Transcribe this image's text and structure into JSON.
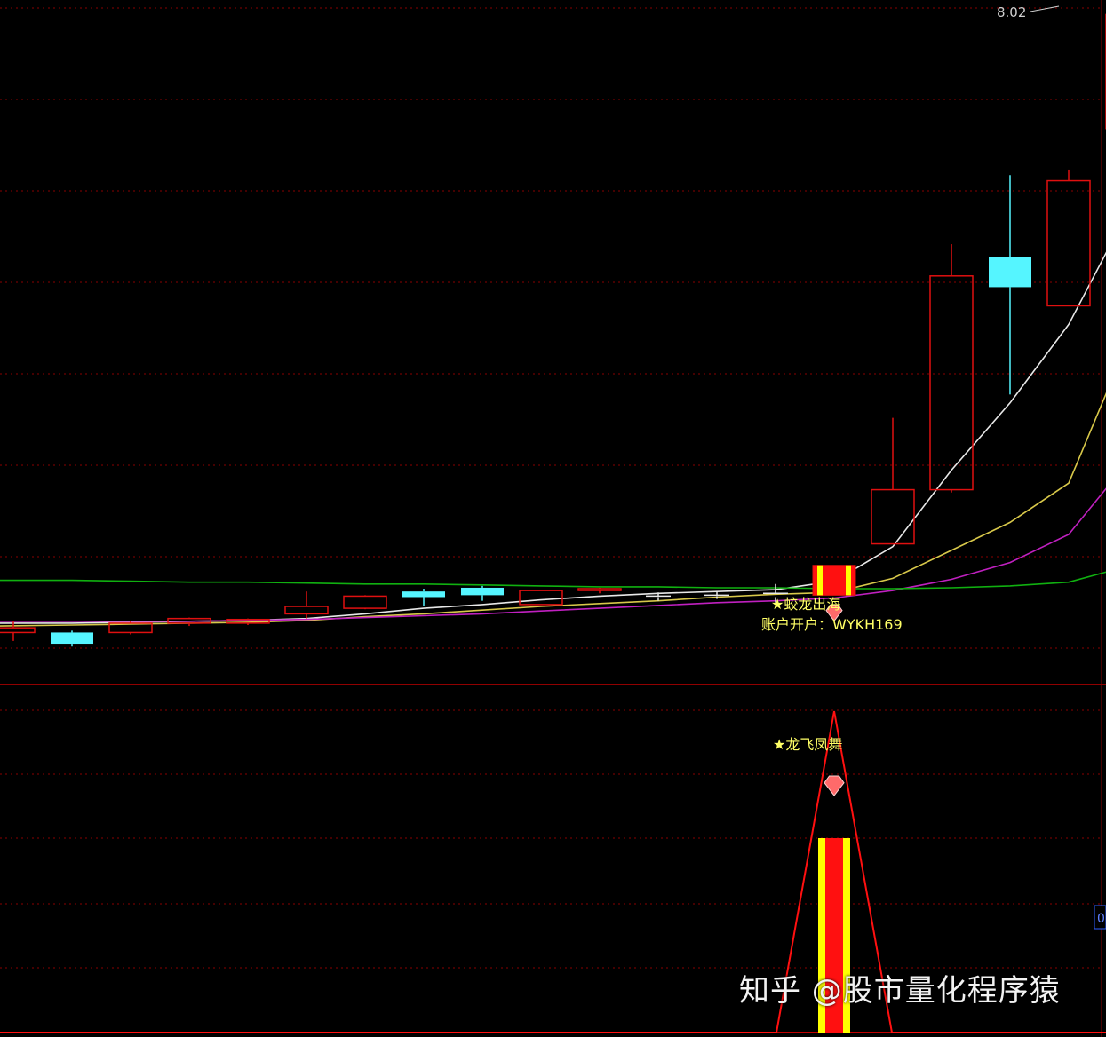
{
  "chart_data": [
    {
      "type": "candlestick",
      "panel": "main",
      "price_readout": "8.02",
      "colors": {
        "up": "#e01010",
        "down": "#55f5ff",
        "doji": "#e8e8e8",
        "grid": "#8a0000",
        "ma_short": "#e8e8e8",
        "ma_mid": "#d8c84a",
        "ma_long": "#c020c0",
        "ma_longest": "#10b010",
        "signal_fill": "#ff1010",
        "signal_stripe": "#ffff00",
        "text": "#ffff66"
      },
      "candles": [
        {
          "i": 0,
          "open": 1.45,
          "high": 1.52,
          "low": 1.31,
          "close": 1.4,
          "dir": "up"
        },
        {
          "i": 1,
          "open": 1.4,
          "high": 1.42,
          "low": 1.25,
          "close": 1.28,
          "dir": "down"
        },
        {
          "i": 2,
          "open": 1.4,
          "high": 1.52,
          "low": 1.38,
          "close": 1.5,
          "dir": "up"
        },
        {
          "i": 3,
          "open": 1.5,
          "high": 1.56,
          "low": 1.47,
          "close": 1.55,
          "dir": "up"
        },
        {
          "i": 4,
          "open": 1.5,
          "high": 1.55,
          "low": 1.48,
          "close": 1.54,
          "dir": "up"
        },
        {
          "i": 5,
          "open": 1.6,
          "high": 1.84,
          "low": 1.55,
          "close": 1.68,
          "dir": "up"
        },
        {
          "i": 6,
          "open": 1.66,
          "high": 1.8,
          "low": 1.65,
          "close": 1.79,
          "dir": "up"
        },
        {
          "i": 7,
          "open": 1.84,
          "high": 1.87,
          "low": 1.68,
          "close": 1.78,
          "dir": "down"
        },
        {
          "i": 8,
          "open": 1.88,
          "high": 1.9,
          "low": 1.74,
          "close": 1.8,
          "dir": "down"
        },
        {
          "i": 9,
          "open": 1.7,
          "high": 1.86,
          "low": 1.7,
          "close": 1.85,
          "dir": "up"
        },
        {
          "i": 10,
          "open": 1.86,
          "high": 1.88,
          "low": 1.82,
          "close": 1.87,
          "dir": "up"
        },
        {
          "i": 11,
          "open": 1.78,
          "high": 1.83,
          "low": 1.74,
          "close": 1.79,
          "dir": "doji"
        },
        {
          "i": 12,
          "open": 1.79,
          "high": 1.84,
          "low": 1.76,
          "close": 1.8,
          "dir": "doji"
        },
        {
          "i": 13,
          "open": 1.78,
          "high": 1.92,
          "low": 1.72,
          "close": 1.82,
          "dir": "doji"
        },
        {
          "i": 14,
          "open": 1.8,
          "high": 2.12,
          "low": 1.8,
          "close": 2.12,
          "dir": "signal"
        },
        {
          "i": 15,
          "open": 2.35,
          "high": 3.7,
          "low": 2.35,
          "close": 2.93,
          "dir": "up"
        },
        {
          "i": 16,
          "open": 2.93,
          "high": 5.56,
          "low": 2.9,
          "close": 5.22,
          "dir": "up"
        },
        {
          "i": 17,
          "open": 5.42,
          "high": 6.3,
          "low": 3.95,
          "close": 5.1,
          "dir": "down"
        },
        {
          "i": 18,
          "open": 4.9,
          "high": 6.36,
          "low": 4.9,
          "close": 6.24,
          "dir": "up"
        },
        {
          "i": 19,
          "open": 6.8,
          "high": 8.02,
          "low": 6.8,
          "close": 8.02,
          "dir": "up"
        }
      ],
      "ma_series": [
        {
          "key": "ma_short",
          "values": [
            1.5,
            1.5,
            1.51,
            1.52,
            1.53,
            1.55,
            1.6,
            1.66,
            1.7,
            1.75,
            1.79,
            1.82,
            1.84,
            1.86,
            1.95,
            2.32,
            3.14,
            3.86,
            4.7,
            5.9
          ]
        },
        {
          "key": "ma_mid",
          "values": [
            1.47,
            1.48,
            1.49,
            1.5,
            1.51,
            1.53,
            1.57,
            1.6,
            1.64,
            1.68,
            1.71,
            1.74,
            1.78,
            1.81,
            1.83,
            1.98,
            2.28,
            2.58,
            3.0,
            4.5
          ]
        },
        {
          "key": "ma_long",
          "values": [
            1.52,
            1.52,
            1.52,
            1.52,
            1.53,
            1.54,
            1.56,
            1.58,
            1.6,
            1.63,
            1.66,
            1.69,
            1.72,
            1.74,
            1.77,
            1.85,
            1.97,
            2.15,
            2.45,
            3.22
          ]
        },
        {
          "key": "ma_longest",
          "values": [
            1.96,
            1.96,
            1.95,
            1.94,
            1.94,
            1.93,
            1.92,
            1.92,
            1.91,
            1.9,
            1.89,
            1.89,
            1.88,
            1.88,
            1.87,
            1.87,
            1.88,
            1.9,
            1.94,
            2.11
          ]
        }
      ],
      "signal_label_1": "★蛟龙出海",
      "signal_label_2": "账户开户：WYKH169"
    },
    {
      "type": "indicator",
      "panel": "sub",
      "triangle_peak_index": 14,
      "bar_index": 14,
      "signal_label": "★龙飞凤舞",
      "edge_value_label": "0"
    }
  ],
  "watermark": "知乎 @股市量化程序猿"
}
